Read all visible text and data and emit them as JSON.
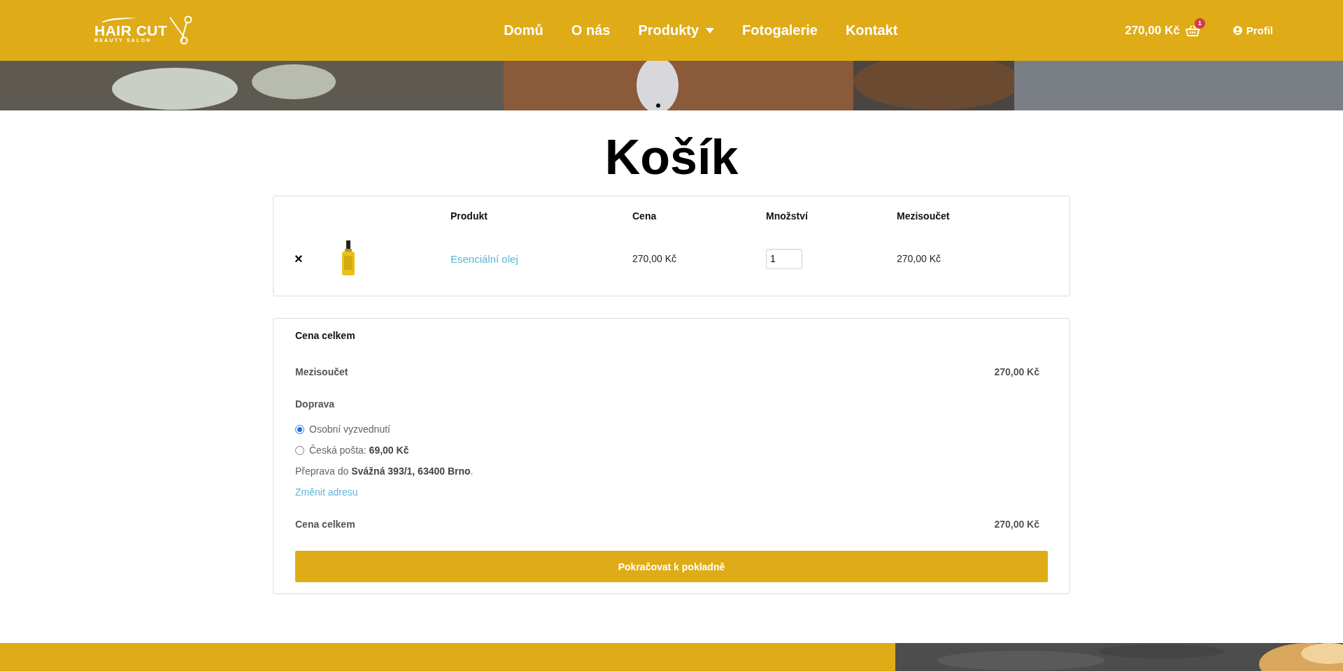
{
  "header": {
    "logo": {
      "title": "HAIR CUT",
      "subtitle": "BEAUTY SALON"
    },
    "nav": [
      {
        "label": "Domů",
        "dropdown": false
      },
      {
        "label": "O nás",
        "dropdown": false
      },
      {
        "label": "Produkty",
        "dropdown": true
      },
      {
        "label": "Fotogalerie",
        "dropdown": false
      },
      {
        "label": "Kontakt",
        "dropdown": false
      }
    ],
    "cart": {
      "total": "270,00 Kč",
      "count": "1"
    },
    "profile": {
      "label": "Profil"
    }
  },
  "page_title": "Košík",
  "cart_table": {
    "columns": [
      "Produkt",
      "Cena",
      "Množství",
      "Mezisoučet"
    ],
    "rows": [
      {
        "remove": "×",
        "product": "Esenciální olej",
        "price": "270,00 Kč",
        "quantity": "1",
        "subtotal": "270,00 Kč"
      }
    ]
  },
  "totals": {
    "title": "Cena celkem",
    "subtotal_label": "Mezisoučet",
    "subtotal": "270,00 Kč",
    "shipping_label": "Doprava",
    "shipping_options": [
      {
        "label": "Osobní vyzvednutí",
        "selected": true
      },
      {
        "label": "Česká pošta: **69,00 Kč**",
        "selected": false
      }
    ],
    "shipping_note": "Přeprava do **Svážná 393/1, 63400 Brno**.",
    "change_address": "Změnit adresu",
    "total_label": "Cena celkem",
    "total": "270,00 Kč",
    "checkout_button": "Pokračovat k pokladně"
  }
}
